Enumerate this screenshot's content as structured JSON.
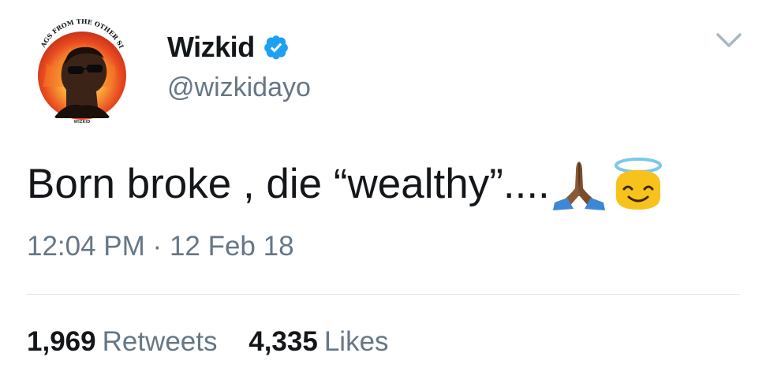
{
  "tweet": {
    "author": {
      "display_name": "Wizkid",
      "handle": "@wizkidayo",
      "verified_icon": "verified-badge-icon",
      "avatar": {
        "arc_text": "SWAGS FROM THE OTHER SIDE",
        "bottom_text": "WIZKID"
      }
    },
    "menu_icon": "chevron-down-icon",
    "text": "Born broke , die “wealthy”....",
    "emojis": [
      "folded-hands-icon",
      "smiling-face-with-halo-icon"
    ],
    "time": "12:04 PM",
    "separator": "·",
    "date": "12 Feb 18",
    "stats": {
      "retweets_count": "1,969",
      "retweets_label": "Retweets",
      "likes_count": "4,335",
      "likes_label": "Likes"
    }
  },
  "colors": {
    "text_primary": "#14171a",
    "text_secondary": "#657786",
    "verified_blue": "#1da1f2",
    "divider": "#e1e8ed"
  }
}
